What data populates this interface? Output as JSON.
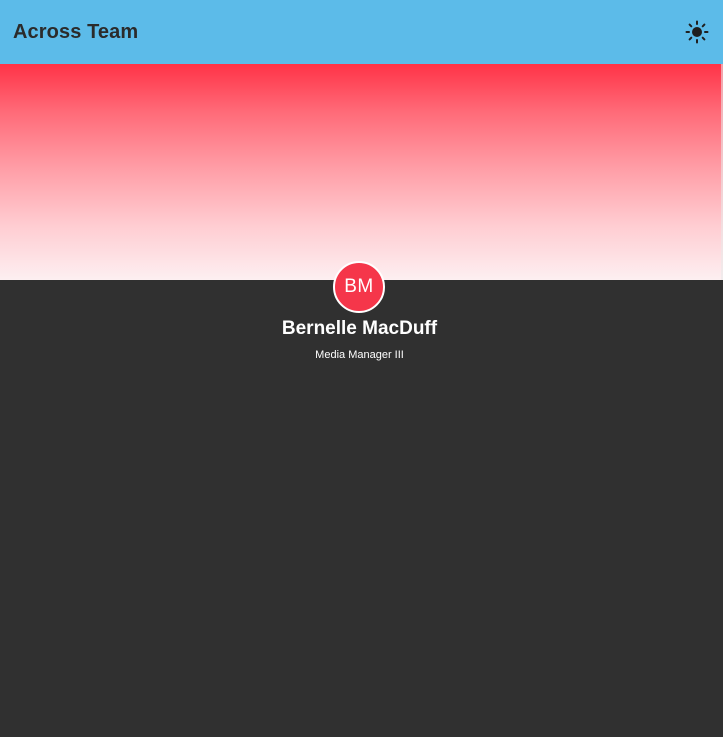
{
  "app": {
    "title": "Across Team",
    "theme_toggle_icon": "sun-icon"
  },
  "profile": {
    "initials": "BM",
    "name": "Bernelle MacDuff",
    "role": "Media Manager III"
  },
  "colors": {
    "topbar": "#5cbbe9",
    "banner_top": "#ff3347",
    "banner_bottom": "#fdeff1",
    "avatar": "#f5364a",
    "page_background": "#303030"
  }
}
